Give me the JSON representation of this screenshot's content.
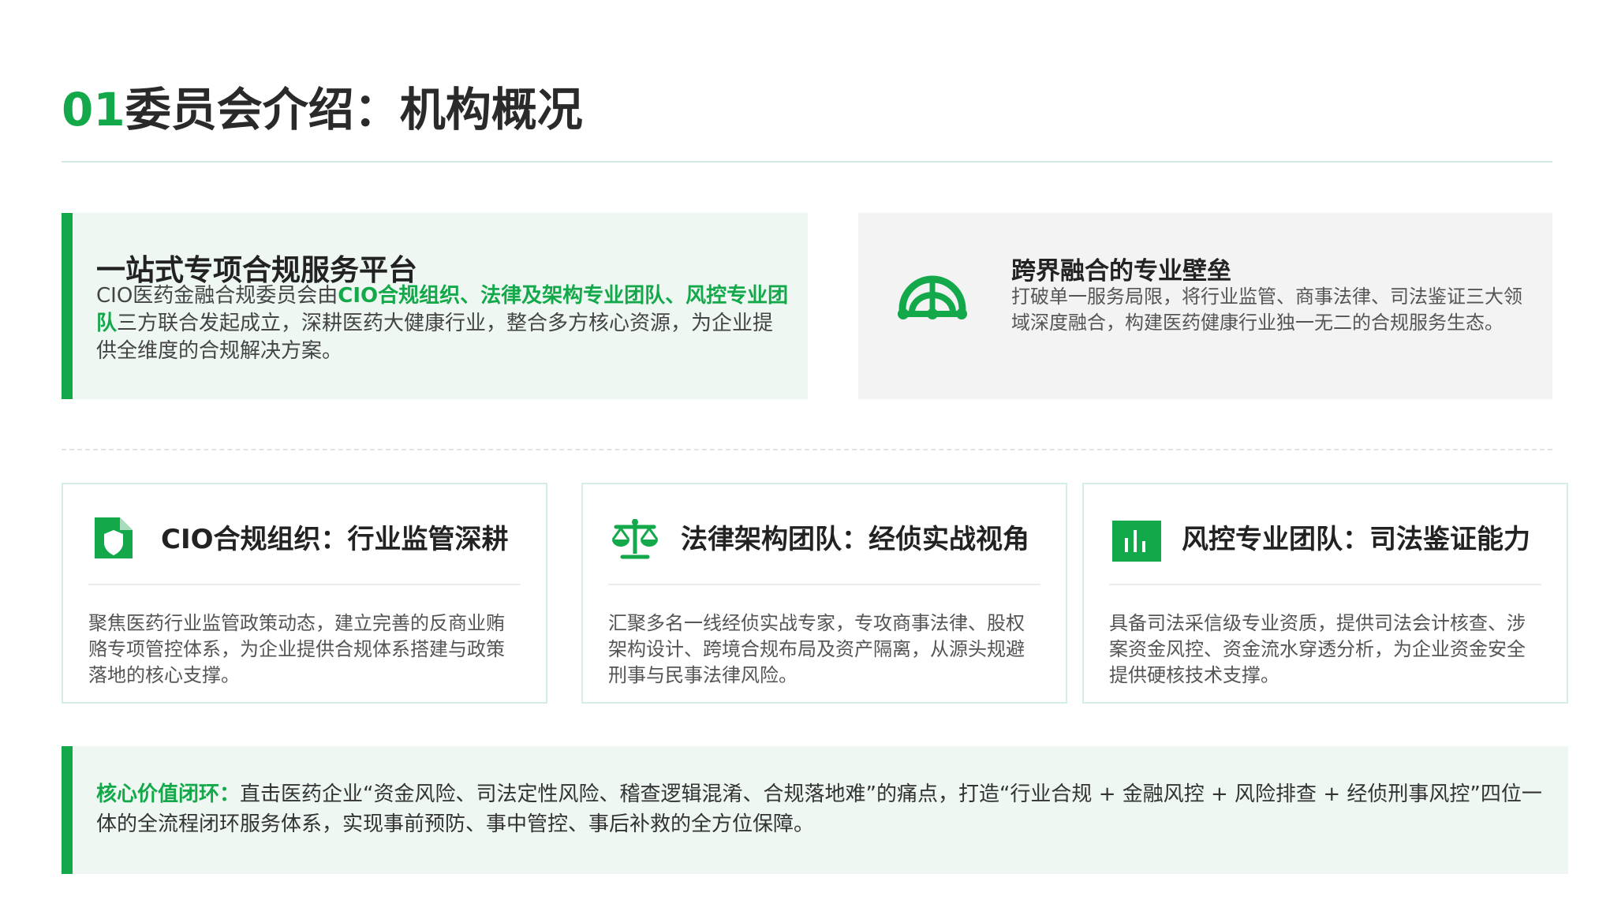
{
  "header": {
    "title_number": "01",
    "title_text": "委员会介绍：机构概况"
  },
  "platform_card": {
    "title": "一站式专项合规服务平台",
    "body_prefix": "CIO医药金融合规委员会由",
    "body_highlight": "CIO合规组织、法律及架构专业团队、风控专业团队",
    "body_suffix": "三方联合发起成立，深耕医药大健康行业，整合多方核心资源，为企业提供全维度的合规解决方案。"
  },
  "barrier_card": {
    "icon": "bridge-icon",
    "title": "跨界融合的专业壁垒",
    "body": "打破单一服务局限，将行业监管、商事法律、司法鉴证三大领域深度融合，构建医药健康行业独一无二的合规服务生态。"
  },
  "teams": [
    {
      "icon": "shield-document-icon",
      "title": "CIO合规组织：行业监管深耕",
      "body": "聚焦医药行业监管政策动态，建立完善的反商业贿赂专项管控体系，为企业提供合规体系搭建与政策落地的核心支撑。"
    },
    {
      "icon": "balance-scale-icon",
      "title": "法律架构团队：经侦实战视角",
      "body": "汇聚多名一线经侦实战专家，专攻商事法律、股权架构设计、跨境合规布局及资产隔离，从源头规避刑事与民事法律风险。"
    },
    {
      "icon": "bar-chart-icon",
      "title": "风控专业团队：司法鉴证能力",
      "body": "具备司法采信级专业资质，提供司法会计核查、涉案资金风控、资金流水穿透分析，为企业资金安全提供硬核技术支撑。"
    }
  ],
  "core_value": {
    "label": "核心价值闭环：",
    "text": "直击医药企业“资金风险、司法定性风险、稽查逻辑混淆、合规落地难”的痛点，打造“行业合规 + 金融风控 + 风险排查 + 经侦刑事风控”四位一体的全流程闭环服务体系，实现事前预防、事中管控、事后补救的全方位保障。"
  },
  "colors": {
    "accent": "#13a84a",
    "light_green_bg": "#eef7f1",
    "gray_bg": "#f3f3f3",
    "border": "#d4eee2"
  }
}
